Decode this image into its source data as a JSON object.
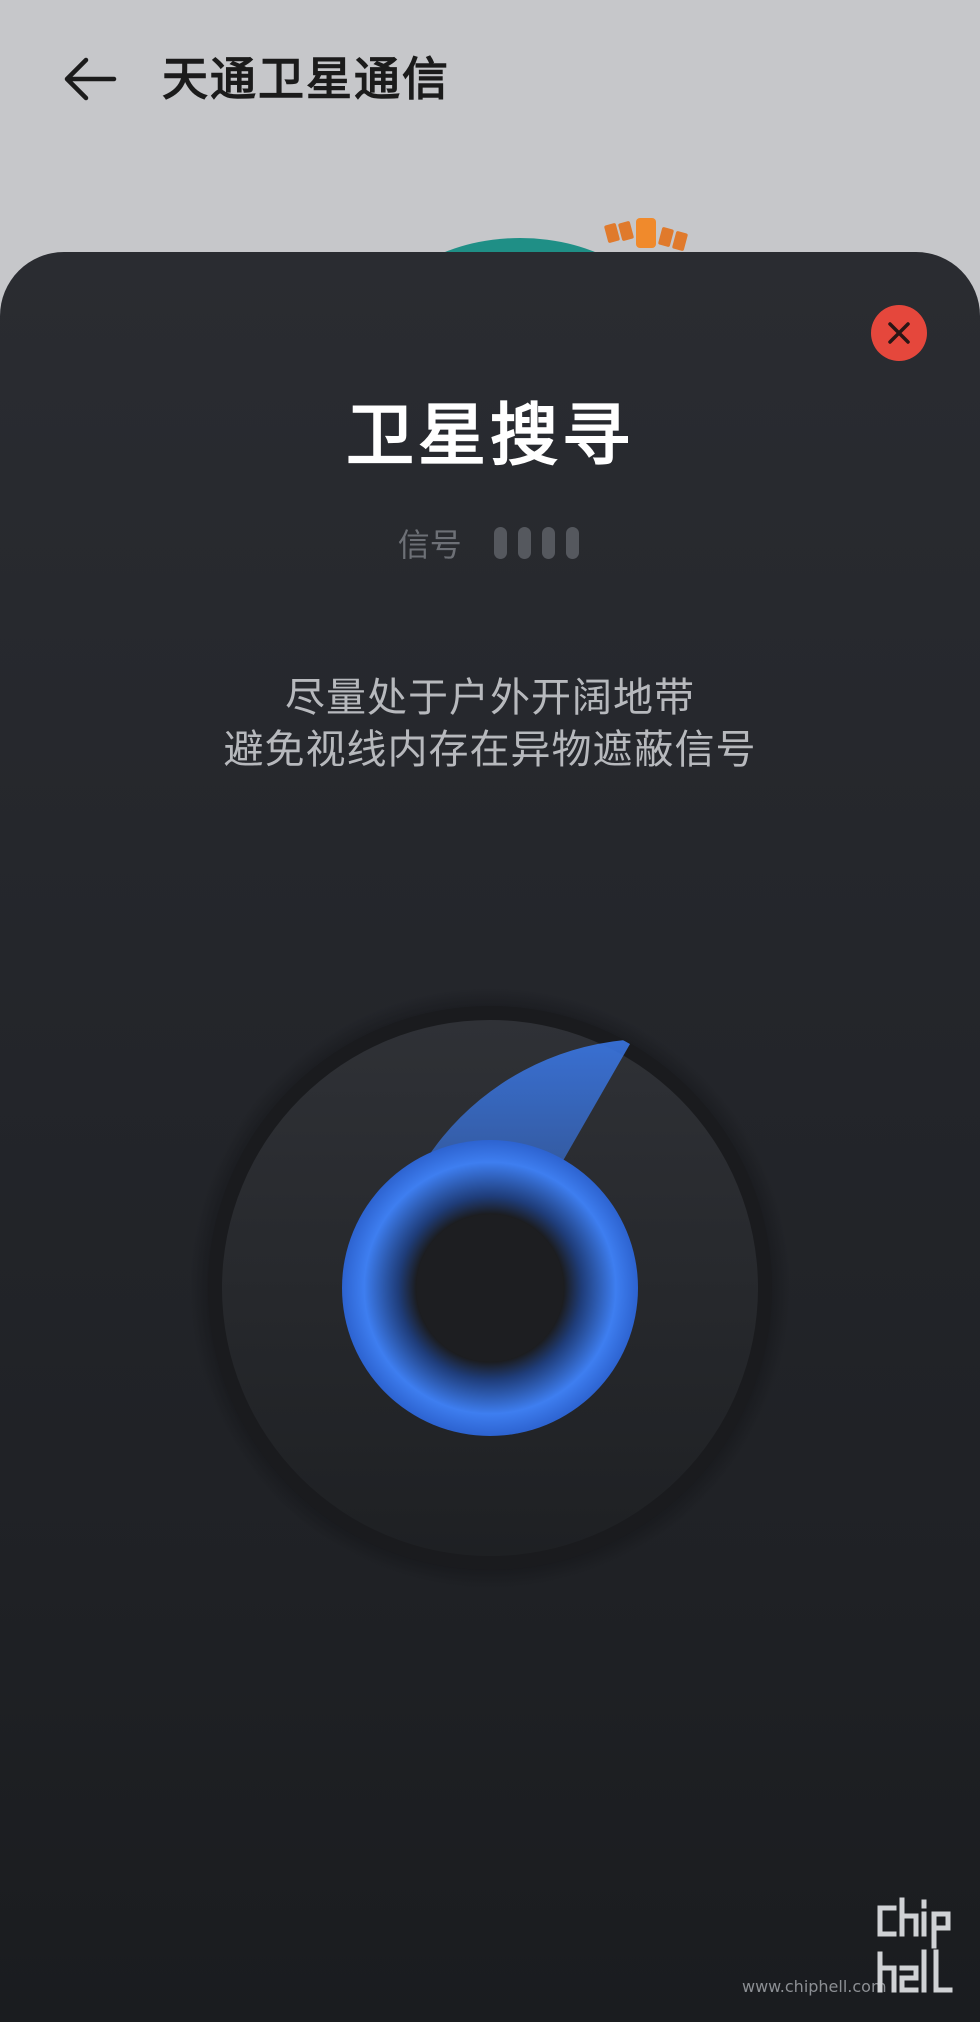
{
  "header": {
    "title": "天通卫星通信"
  },
  "sheet": {
    "title": "卫星搜寻",
    "signal_label": "信号",
    "signal_bars_total": 4,
    "signal_bars_active": 0,
    "hint_line1": "尽量处于户外开阔地带",
    "hint_line2": "避免视线内存在异物遮蔽信号"
  },
  "watermark": {
    "url": "www.chiphell.com",
    "logo_text": "chip hell"
  },
  "colors": {
    "close_button": "#e5473c",
    "radar_blue": "#3a78e8",
    "sheet_background": "#24262b",
    "page_background": "#c6c7ca"
  },
  "icons": {
    "back": "arrow-left-icon",
    "close": "close-icon",
    "radar": "radar-icon",
    "satellite": "satellite-icon"
  }
}
